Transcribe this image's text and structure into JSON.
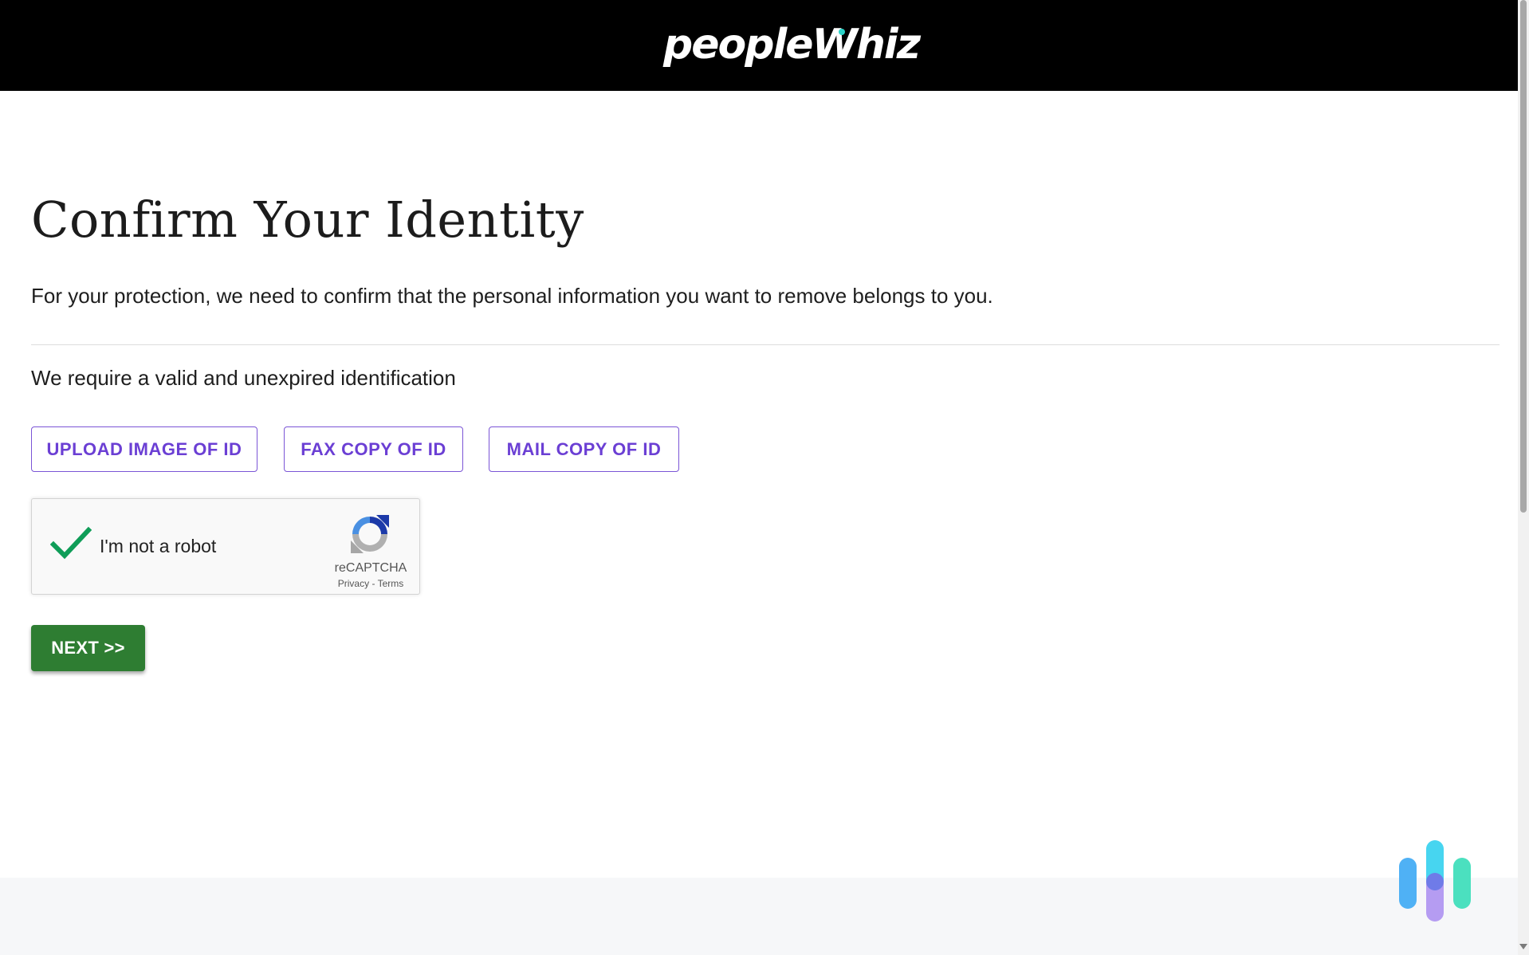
{
  "header": {
    "logo_text": "peopleWhiz",
    "background": "#000000",
    "accent_color": "#2ad3c8"
  },
  "main": {
    "title": "Confirm Your Identity",
    "subtitle": "For your protection, we need to confirm that the personal information you want to remove belongs to you.",
    "requirement_text": "We require a valid and unexpired identification",
    "id_options": [
      {
        "label": "UPLOAD IMAGE OF ID"
      },
      {
        "label": "FAX COPY OF ID"
      },
      {
        "label": "MAIL COPY OF ID"
      }
    ],
    "option_color": "#6b3fd4"
  },
  "captcha": {
    "label": "I'm not a robot",
    "checked": true,
    "brand": "reCAPTCHA",
    "privacy_label": "Privacy",
    "separator": "-",
    "terms_label": "Terms",
    "check_icon": "checkmark-icon",
    "logo_icon": "recaptcha-logo-icon",
    "check_color": "#0f9d58"
  },
  "next_button": {
    "label": "NEXT >>",
    "color": "#2e7d32"
  },
  "floating_widget": {
    "icon": "bars-logo-icon"
  }
}
